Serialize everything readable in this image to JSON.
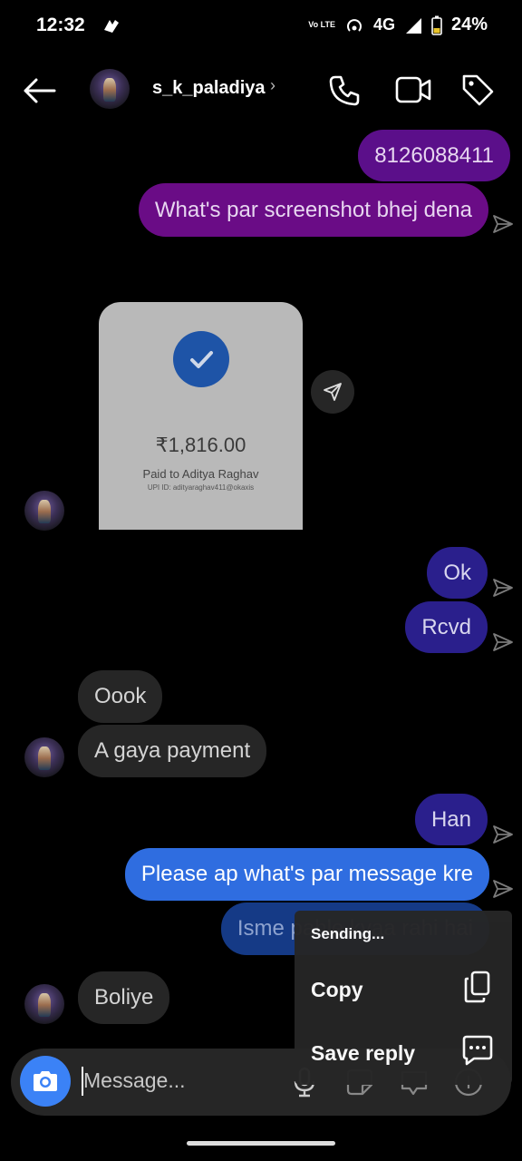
{
  "status_bar": {
    "time": "12:32",
    "network": "4G",
    "volte": "Vo LTE",
    "battery": "24%"
  },
  "header": {
    "username": "s_k_paladiya",
    "chevron": "›",
    "icons": [
      "back-arrow-icon",
      "phone-icon",
      "video-call-icon",
      "tag-icon"
    ]
  },
  "messages": [
    {
      "side": "sent",
      "text": "8126088411"
    },
    {
      "side": "sent",
      "text": "What's par screenshot bhej dena"
    },
    {
      "side": "received",
      "type": "payment-screenshot",
      "amount": "₹1,816.00",
      "paid_to": "Paid to Aditya Raghav",
      "upi": "UPI ID: adityaraghav411@okaxis"
    },
    {
      "side": "sent",
      "text": "Ok"
    },
    {
      "side": "sent",
      "text": "Rcvd"
    },
    {
      "side": "received",
      "text": "Oook"
    },
    {
      "side": "received",
      "text": "A gaya payment"
    },
    {
      "side": "sent",
      "text": "Han"
    },
    {
      "side": "sent",
      "text": "Please ap what's par message kre",
      "highlighted": true
    },
    {
      "side": "sent",
      "text": "Isme pahle kyaa rahi hai",
      "dimmed": true
    },
    {
      "side": "received",
      "text": "Boliye"
    }
  ],
  "context_menu": {
    "status": "Sending...",
    "items": [
      {
        "label": "Copy",
        "icon": "copy-icon"
      },
      {
        "label": "Save reply",
        "icon": "save-reply-icon"
      }
    ]
  },
  "composer": {
    "placeholder": "Message...",
    "icons": [
      "camera-icon",
      "microphone-icon",
      "sticker-icon",
      "gif-icon",
      "more-icon"
    ]
  },
  "colors": {
    "sent_purple": "#5b0f8a",
    "sent_indigo": "#2a1f8c",
    "sent_blue": "#2f6de0",
    "received_gray": "#262626",
    "camera_blue": "#3b82f6"
  }
}
